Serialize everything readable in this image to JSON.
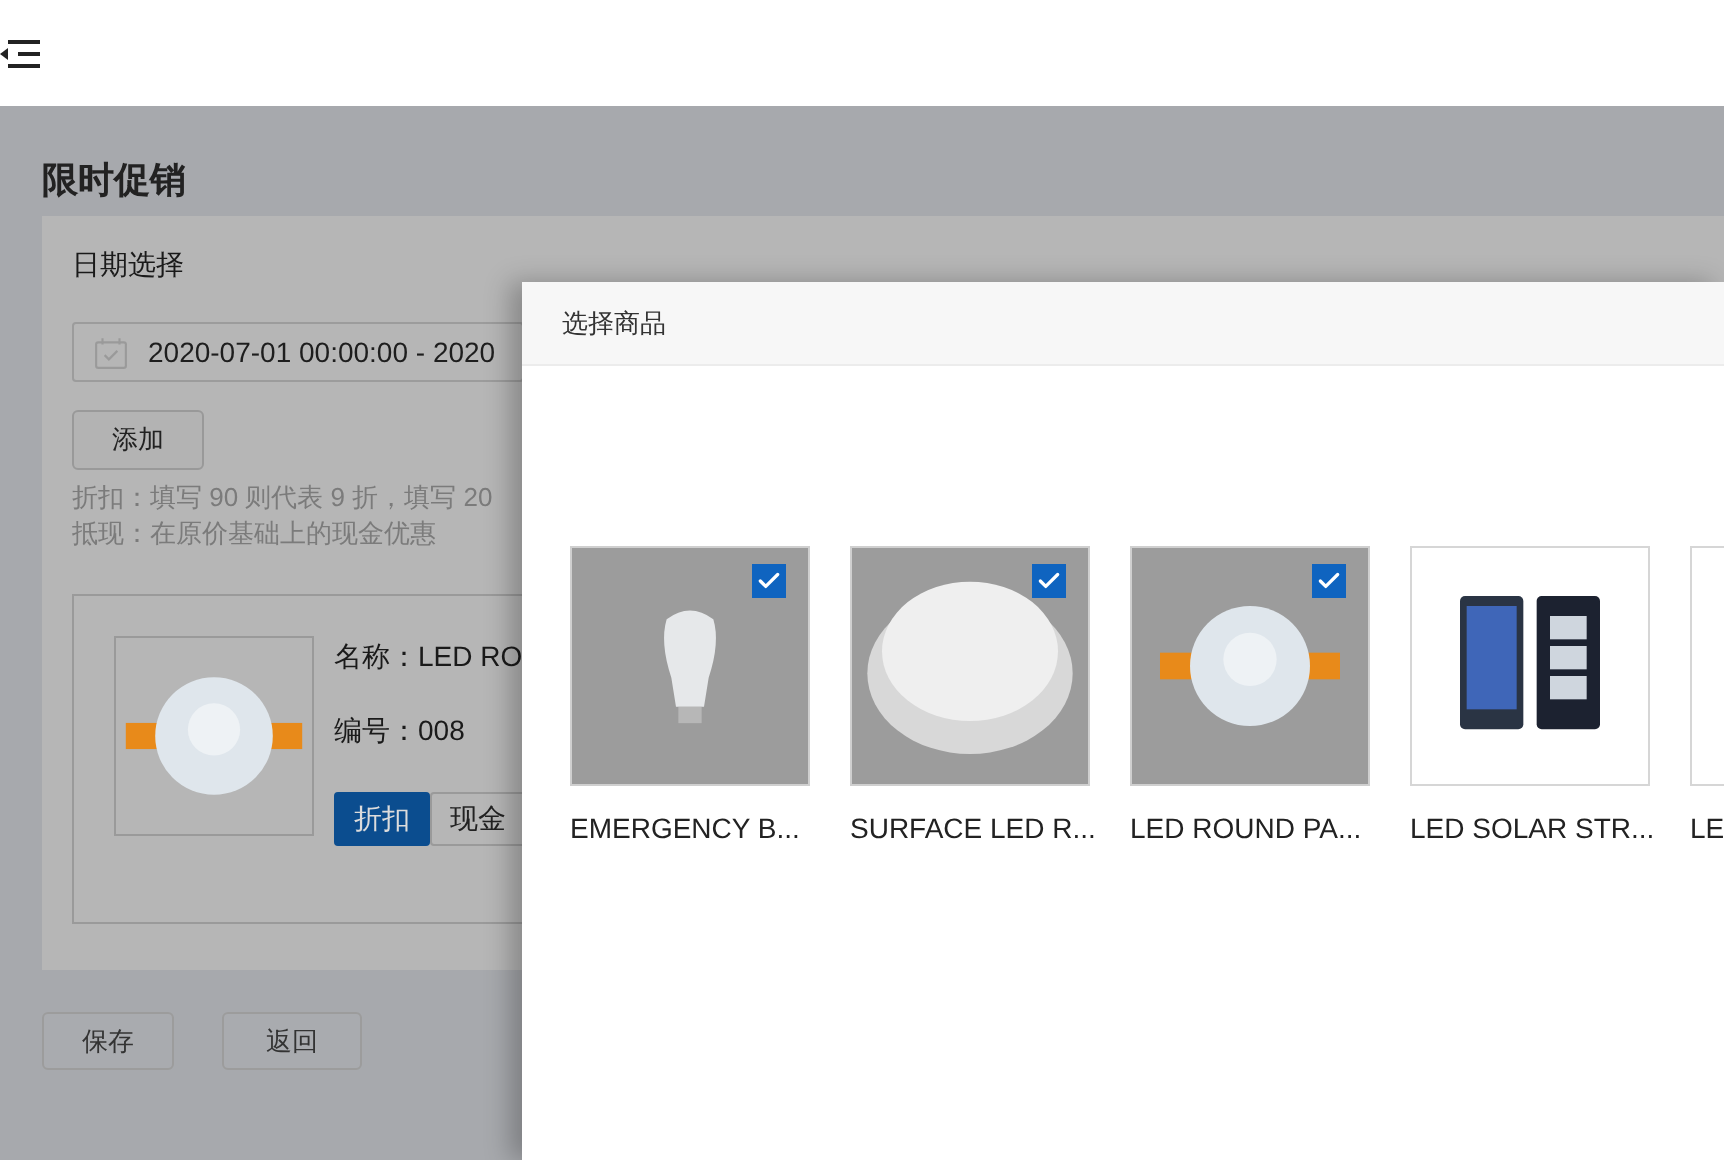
{
  "page": {
    "title": "限时促销",
    "section_label": "日期选择",
    "date_range": "2020-07-01 00:00:00 - 2020",
    "add_button": "添加",
    "notes": [
      "折扣：填写 90 则代表 9 折，填写 20",
      "抵现：在原价基础上的现金优惠"
    ],
    "product": {
      "name": "名称：LED RO",
      "code": "编号：008",
      "modes": [
        {
          "label": "折扣",
          "selected": true
        },
        {
          "label": "现金",
          "selected": false
        }
      ]
    },
    "actions": [
      "保存",
      "返回"
    ]
  },
  "modal": {
    "title": "选择商品",
    "products": [
      {
        "name": "EMERGENCY B...",
        "kind": "bulb",
        "selected": true
      },
      {
        "name": "SURFACE LED R...",
        "kind": "panel",
        "selected": true
      },
      {
        "name": "LED ROUND PA...",
        "kind": "downlight",
        "selected": true
      },
      {
        "name": "LED SOLAR STR...",
        "kind": "solar",
        "selected": false
      },
      {
        "name": "LE",
        "kind": "blank",
        "selected": false
      }
    ]
  }
}
